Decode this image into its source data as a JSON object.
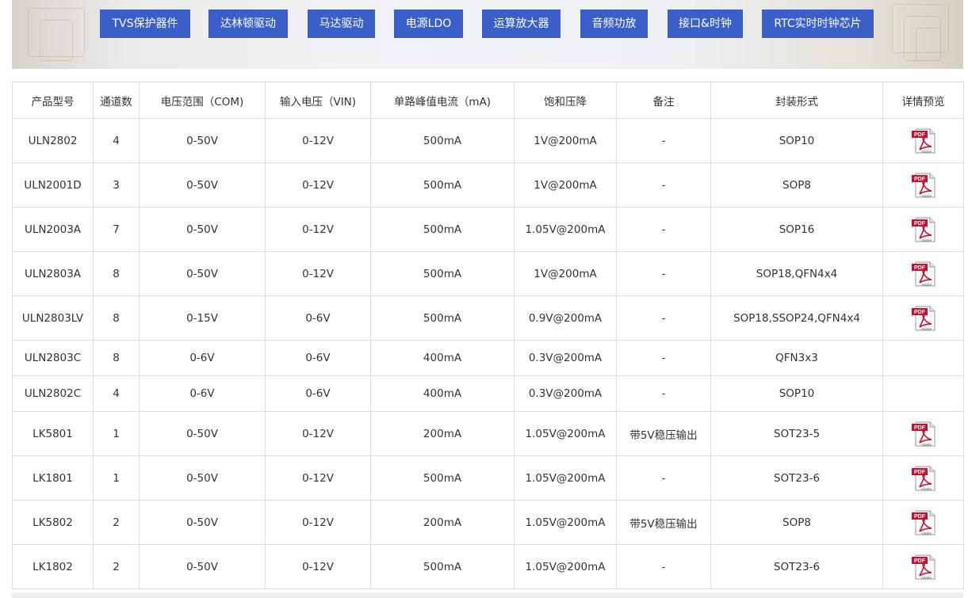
{
  "nav": [
    {
      "label": "TVS保护器件"
    },
    {
      "label": "达林顿驱动"
    },
    {
      "label": "马达驱动"
    },
    {
      "label": "电源LDO"
    },
    {
      "label": "运算放大器"
    },
    {
      "label": "音频功放"
    },
    {
      "label": "接口&时钟"
    },
    {
      "label": "RTC实时时钟芯片"
    }
  ],
  "table": {
    "headers": [
      "产品型号",
      "通道数",
      "电压范围（COM)",
      "输入电压（VIN)",
      "单路峰值电流（mA)",
      "饱和压降",
      "备注",
      "封装形式",
      "详情预览"
    ],
    "rows": [
      {
        "model": "ULN2802",
        "channels": "4",
        "vcom": "0-50V",
        "vin": "0-12V",
        "current": "500mA",
        "vsat": "1V@200mA",
        "note": "-",
        "package": "SOP10",
        "pdf": "pdf-icon"
      },
      {
        "model": "ULN2001D",
        "channels": "3",
        "vcom": "0-50V",
        "vin": "0-12V",
        "current": "500mA",
        "vsat": "1V@200mA",
        "note": "-",
        "package": "SOP8",
        "pdf": "pdf-icon"
      },
      {
        "model": "ULN2003A",
        "channels": "7",
        "vcom": "0-50V",
        "vin": "0-12V",
        "current": "500mA",
        "vsat": "1.05V@200mA",
        "note": "-",
        "package": "SOP16",
        "pdf": "pdf-icon"
      },
      {
        "model": "ULN2803A",
        "channels": "8",
        "vcom": "0-50V",
        "vin": "0-12V",
        "current": "500mA",
        "vsat": "1V@200mA",
        "note": "-",
        "package": "SOP18,QFN4x4",
        "pdf": "pdf-icon"
      },
      {
        "model": "ULN2803LV",
        "channels": "8",
        "vcom": "0-15V",
        "vin": "0-6V",
        "current": "500mA",
        "vsat": "0.9V@200mA",
        "note": "-",
        "package": "SOP18,SSOP24,QFN4x4",
        "pdf": "pdf-icon"
      },
      {
        "model": "ULN2803C",
        "channels": "8",
        "vcom": "0-6V",
        "vin": "0-6V",
        "current": "400mA",
        "vsat": "0.3V@200mA",
        "note": "-",
        "package": "QFN3x3",
        "pdf": ""
      },
      {
        "model": "ULN2802C",
        "channels": "4",
        "vcom": "0-6V",
        "vin": "0-6V",
        "current": "400mA",
        "vsat": "0.3V@200mA",
        "note": "-",
        "package": "SOP10",
        "pdf": ""
      },
      {
        "model": "LK5801",
        "channels": "1",
        "vcom": "0-50V",
        "vin": "0-12V",
        "current": "200mA",
        "vsat": "1.05V@200mA",
        "note": "带5V稳压输出",
        "package": "SOT23-5",
        "pdf": "pdf-icon"
      },
      {
        "model": "LK1801",
        "channels": "1",
        "vcom": "0-50V",
        "vin": "0-12V",
        "current": "500mA",
        "vsat": "1.05V@200mA",
        "note": "-",
        "package": "SOT23-6",
        "pdf": "pdf-icon"
      },
      {
        "model": "LK5802",
        "channels": "2",
        "vcom": "0-50V",
        "vin": "0-12V",
        "current": "200mA",
        "vsat": "1.05V@200mA",
        "note": "带5V稳压输出",
        "package": "SOP8",
        "pdf": "pdf-icon"
      },
      {
        "model": "LK1802",
        "channels": "2",
        "vcom": "0-50V",
        "vin": "0-12V",
        "current": "500mA",
        "vsat": "1.05V@200mA",
        "note": "-",
        "package": "SOT23-6",
        "pdf": "pdf-icon"
      }
    ]
  },
  "colors": {
    "nav_bg": "#3a5fc9",
    "pdf_red": "#c8102e"
  }
}
